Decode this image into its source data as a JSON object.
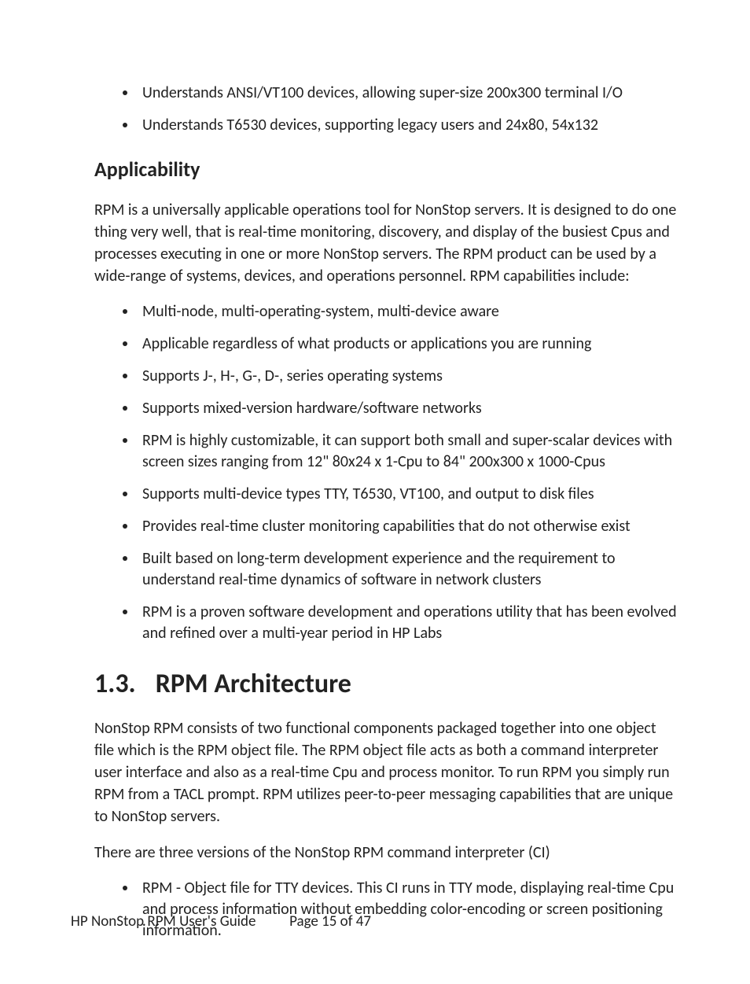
{
  "top_bullets": [
    "Understands ANSI/VT100 devices, allowing super-size 200x300 terminal I/O",
    "Understands T6530 devices, supporting legacy users and 24x80, 54x132"
  ],
  "applicability": {
    "heading": "Applicability",
    "intro": "RPM is a universally applicable operations tool for NonStop servers. It is designed to do one thing very well, that is real-time monitoring, discovery, and display of the busiest Cpus and processes executing in one or more NonStop servers. The RPM product can be used by a wide-range of systems, devices, and operations personnel. RPM capabilities include:",
    "bullets": [
      "Multi-node, multi-operating-system, multi-device aware",
      "Applicable regardless of what products or applications you are running",
      "Supports J-, H-, G-, D-, series operating systems",
      "Supports mixed-version hardware/software networks",
      "RPM is highly customizable, it can support both small and super-scalar devices with screen sizes ranging from 12\" 80x24 x 1-Cpu to 84\" 200x300 x 1000-Cpus",
      "Supports multi-device types TTY, T6530, VT100, and output to disk files",
      "Provides real-time cluster monitoring capabilities that do not otherwise exist",
      "Built based on long-term development experience and the requirement to understand real-time dynamics of software in network clusters",
      "RPM is a proven software development and operations utility that has been evolved and refined over a multi-year period in HP Labs"
    ]
  },
  "architecture": {
    "number": "1.3.",
    "title": "RPM Architecture",
    "p1": "NonStop RPM consists of two functional components packaged together into one object file which is the RPM object file. The RPM object file acts as both a command interpreter user interface and also as a real-time Cpu and process monitor.  To run RPM you simply run RPM from a TACL prompt.  RPM utilizes peer-to-peer messaging capabilities that are unique to NonStop servers.",
    "p2": "There are three versions of the NonStop RPM command interpreter (CI)",
    "bullets": [
      "RPM - Object file for TTY devices.  This CI runs in TTY mode, displaying real-time Cpu and process information without embedding color-encoding or screen positioning information."
    ]
  },
  "footer": {
    "doc": "HP NonStop RPM User's Guide",
    "page": "Page 15 of 47"
  }
}
